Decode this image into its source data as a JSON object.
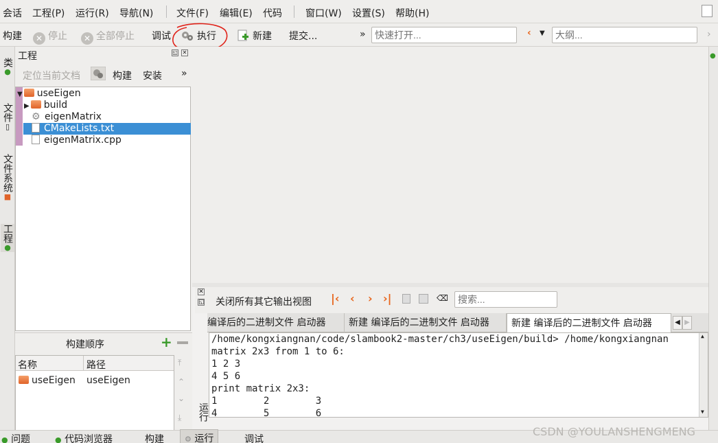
{
  "menubar": {
    "items": [
      "会话",
      "工程(P)",
      "运行(R)",
      "导航(N)",
      "文件(F)",
      "编辑(E)",
      "代码",
      "窗口(W)",
      "设置(S)",
      "帮助(H)"
    ]
  },
  "toolbar": {
    "build": "构建",
    "stop": "停止",
    "stop_all": "全部停止",
    "debug": "调试",
    "run": "执行",
    "new": "新建",
    "commit": "提交...",
    "more": "»",
    "quick_open_placeholder": "快速打开...",
    "outline_placeholder": "大纲..."
  },
  "left_tabs": [
    "类",
    "文件",
    "文件系统",
    "工程"
  ],
  "project_panel": {
    "title": "工程",
    "locate": "定位当前文档",
    "build": "构建",
    "install": "安装",
    "more": "»",
    "tree": [
      {
        "label": "useEigen",
        "type": "folder",
        "level": 0,
        "expanded": true,
        "selected": false
      },
      {
        "label": "build",
        "type": "folder",
        "level": 1,
        "expanded": false,
        "selected": false
      },
      {
        "label": "eigenMatrix",
        "type": "target",
        "level": 1,
        "selected": false
      },
      {
        "label": "CMakeLists.txt",
        "type": "file",
        "level": 1,
        "selected": true
      },
      {
        "label": "eigenMatrix.cpp",
        "type": "file",
        "level": 1,
        "selected": false
      }
    ]
  },
  "build_order": {
    "title": "构建顺序",
    "col_name": "名称",
    "col_path": "路径",
    "rows": [
      {
        "name": "useEigen",
        "path": "useEigen"
      }
    ]
  },
  "output": {
    "close_others": "关闭所有其它输出视图",
    "search_placeholder": "搜索...",
    "tabs": [
      "编译后的二进制文件 启动器",
      "新建 编译后的二进制文件 启动器",
      "新建 编译后的二进制文件 启动器"
    ],
    "side_label": "运行",
    "lines": [
      "/home/kongxiangnan/code/slambook2-master/ch3/useEigen/build> /home/kongxiangnan",
      "matrix 2x3 from 1 to 6:",
      "1 2 3",
      "4 5 6",
      "print matrix 2x3:",
      "1        2        3",
      "4        5        6"
    ]
  },
  "bottombar": {
    "items": [
      "问题",
      "代码浏览器",
      "构建",
      "运行",
      "调试"
    ]
  },
  "watermark": "CSDN @YOULANSHENGMENG",
  "colors": {
    "selection": "#3b8fd5",
    "annotation": "#e0231a",
    "accent": "#e8651c"
  }
}
